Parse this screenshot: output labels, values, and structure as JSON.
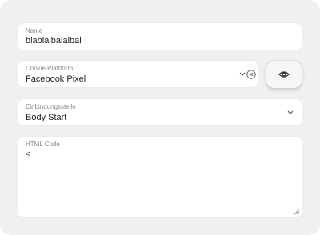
{
  "name_field": {
    "label": "Name",
    "value": "blablalbalalbal"
  },
  "platform_field": {
    "label": "Cookie Plattform",
    "value": "Facebook Pixel"
  },
  "position_field": {
    "label": "Einbindungsstelle",
    "value": "Body Start"
  },
  "html_field": {
    "label": "HTML Code",
    "value": "<"
  },
  "icons": {
    "platform_chevron": "chevron-down-icon",
    "platform_clear": "clear-icon",
    "preview": "eye-icon",
    "position_chevron": "chevron-down-icon",
    "resize": "resize-handle-icon"
  }
}
